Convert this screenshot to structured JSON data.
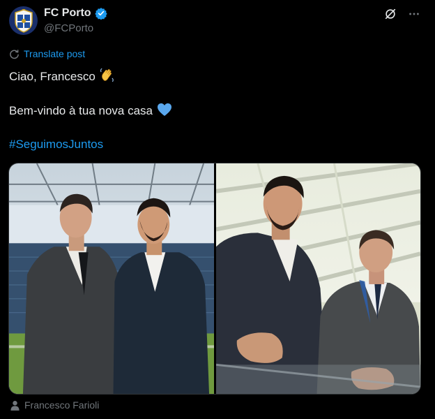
{
  "tweet": {
    "display_name": "FC Porto",
    "handle": "@FCPorto",
    "translate_label": "Translate post",
    "line1": "Ciao, Francesco",
    "line2": "Bem-vindo à tua nova casa",
    "hashtag": "#SeguimosJuntos",
    "media_caption": "Francesco Farioli"
  },
  "icons": {
    "verified": "verified-badge-icon",
    "grok": "grok-icon",
    "more": "more-options-icon",
    "translate": "translate-icon",
    "wave_emoji": "waving-hand-emoji",
    "heart_emoji": "blue-heart-emoji",
    "person": "person-tag-icon"
  },
  "colors": {
    "background": "#000000",
    "text": "#e7e9ea",
    "secondary_text": "#71767b",
    "link": "#1d9bf0",
    "verified": "#1d9bf0",
    "avatar_bg": "#1a2f6b"
  }
}
